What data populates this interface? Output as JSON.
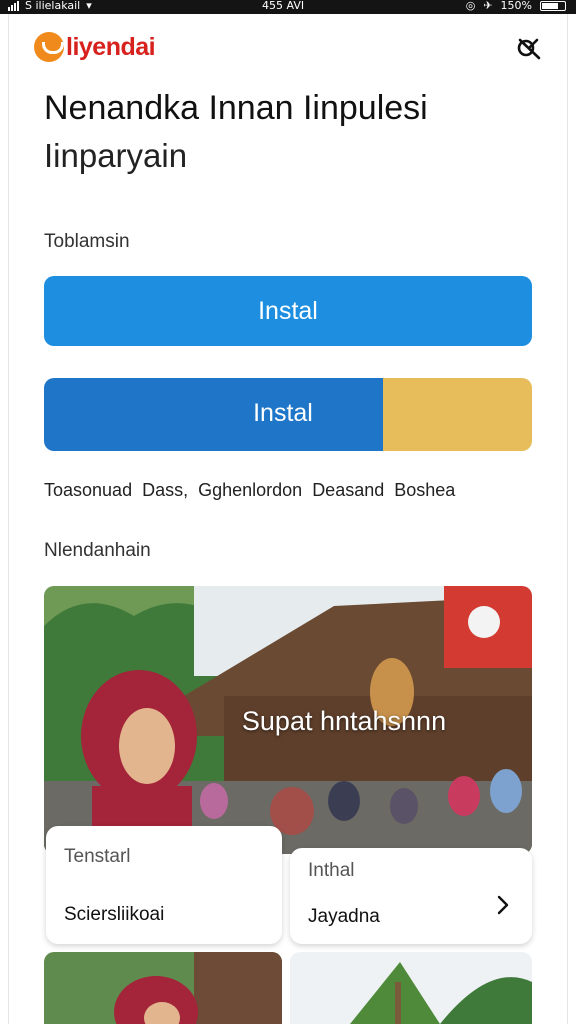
{
  "status_bar": {
    "carrier": "S ilielakail",
    "time": "455 AVI",
    "battery": "150%"
  },
  "header": {
    "logo_text": "liyendai",
    "close_icon": "close-icon",
    "title": "Nenandka Innan Iinpulesi",
    "subtitle": "Iinparyain"
  },
  "section1": {
    "label": "Toblamsin",
    "primary_button": "Instal",
    "split_button": "Instal"
  },
  "links": [
    "Toasonuad",
    "Dass,",
    "Gghenlordon",
    "Deasand",
    "Boshea"
  ],
  "section2": {
    "label": "Nlendanhain",
    "hero_caption": "Supat hntahsnnn",
    "cards": [
      {
        "top": "Tenstarl",
        "bottom": "Sciersliikoai"
      },
      {
        "top": "Inthal",
        "bottom": "Jayadna"
      }
    ]
  },
  "colors": {
    "primary_blue": "#1e8fe0",
    "split_blue": "#1f76c8",
    "split_gold": "#e7bd5b",
    "logo_orange": "#f08a1c",
    "logo_red": "#d7211d"
  }
}
